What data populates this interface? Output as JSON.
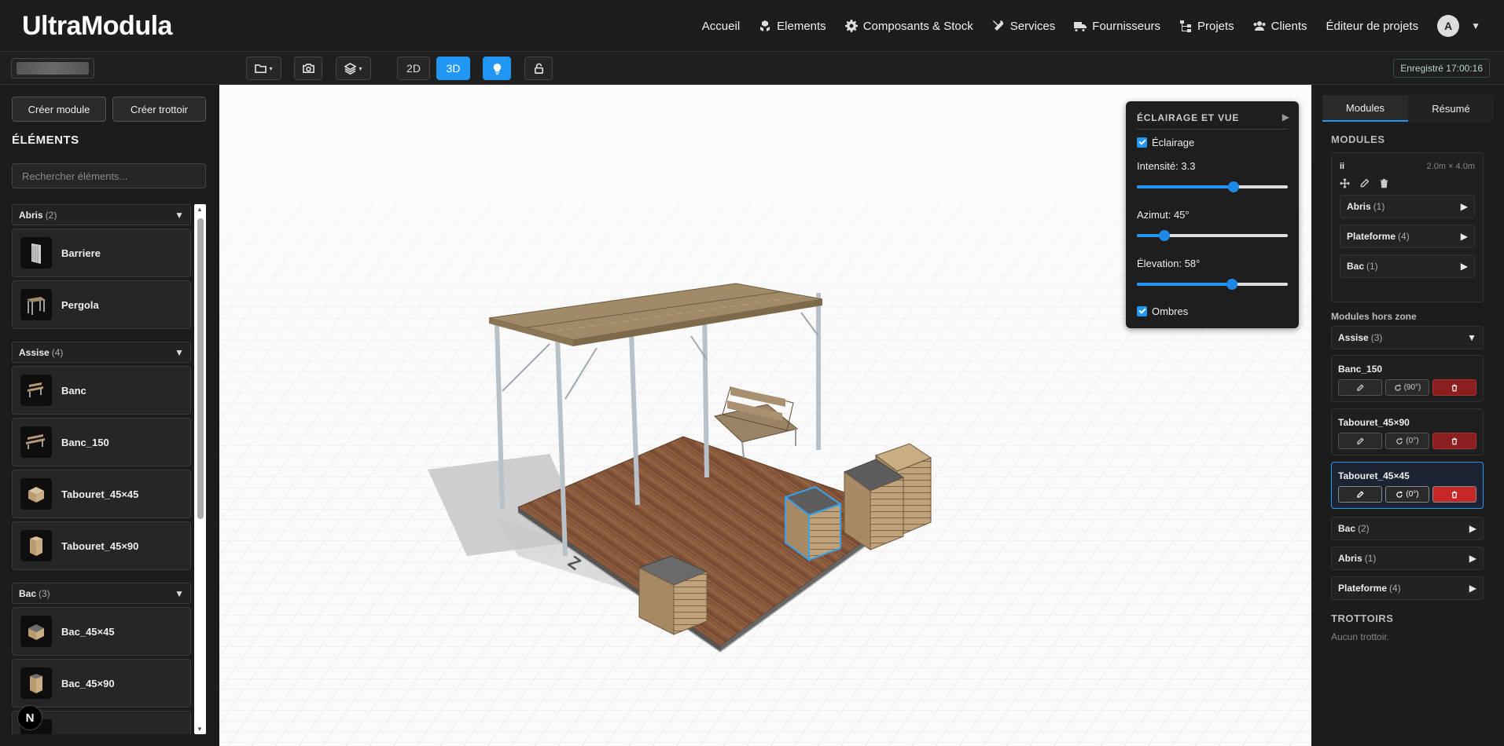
{
  "brand": "UltraModula",
  "nav": {
    "items": [
      {
        "label": "Accueil",
        "icon": ""
      },
      {
        "label": "Elements",
        "icon": "cubes-icon"
      },
      {
        "label": "Composants & Stock",
        "icon": "gear-icon"
      },
      {
        "label": "Services",
        "icon": "tools-icon"
      },
      {
        "label": "Fournisseurs",
        "icon": "truck-icon"
      },
      {
        "label": "Projets",
        "icon": "sitemap-icon"
      },
      {
        "label": "Clients",
        "icon": "users-icon"
      },
      {
        "label": "Éditeur de projets",
        "icon": ""
      }
    ],
    "avatar": "A"
  },
  "toolbar": {
    "view_2d": "2D",
    "view_3d": "3D",
    "active_view": "3D",
    "saved": "Enregistré 17:00:16"
  },
  "left": {
    "create_module": "Créer module",
    "create_trottoir": "Créer trottoir",
    "section_title": "ÉLÉMENTS",
    "search_placeholder": "Rechercher éléments...",
    "groups": [
      {
        "name": "Abris",
        "count": "(2)",
        "items": [
          "Barriere",
          "Pergola"
        ]
      },
      {
        "name": "Assise",
        "count": "(4)",
        "items": [
          "Banc",
          "Banc_150",
          "Tabouret_45×45",
          "Tabouret_45×90"
        ]
      },
      {
        "name": "Bac",
        "count": "(3)",
        "items": [
          "Bac_45×45",
          "Bac_45×90"
        ]
      }
    ],
    "badge": "N"
  },
  "lighting": {
    "title": "ÉCLAIRAGE ET VUE",
    "lighting_label": "Éclairage",
    "lighting_on": true,
    "intensity_label": "Intensité: 3.3",
    "intensity_fraction": 0.64,
    "azimuth_label": "Azimut: 45°",
    "azimuth_fraction": 0.18,
    "elevation_label": "Élevation: 58°",
    "elevation_fraction": 0.63,
    "shadows_label": "Ombres",
    "shadows_on": true
  },
  "right": {
    "tabs": [
      "Modules",
      "Résumé"
    ],
    "active_tab": "Modules",
    "modules_title": "MODULES",
    "module": {
      "name": "ii",
      "dims": "2.0m × 4.0m",
      "subgroups": [
        {
          "name": "Abris",
          "count": "(1)"
        },
        {
          "name": "Plateforme",
          "count": "(4)"
        },
        {
          "name": "Bac",
          "count": "(1)"
        }
      ]
    },
    "outside_title": "Modules hors zone",
    "assise": {
      "name": "Assise",
      "count": "(3)"
    },
    "outside_items": [
      {
        "name": "Banc_150",
        "rotation": "(90°)"
      },
      {
        "name": "Tabouret_45×90",
        "rotation": "(0°)"
      },
      {
        "name": "Tabouret_45×45",
        "rotation": "(0°)",
        "selected": true
      }
    ],
    "more_groups": [
      {
        "name": "Bac",
        "count": "(2)"
      },
      {
        "name": "Abris",
        "count": "(1)"
      },
      {
        "name": "Plateforme",
        "count": "(4)"
      }
    ],
    "trottoirs_title": "TROTTOIRS",
    "no_trottoir": "Aucun trottoir."
  },
  "colors": {
    "accent": "#2196f3",
    "danger": "#c62828",
    "background": "#1c1c1c"
  }
}
